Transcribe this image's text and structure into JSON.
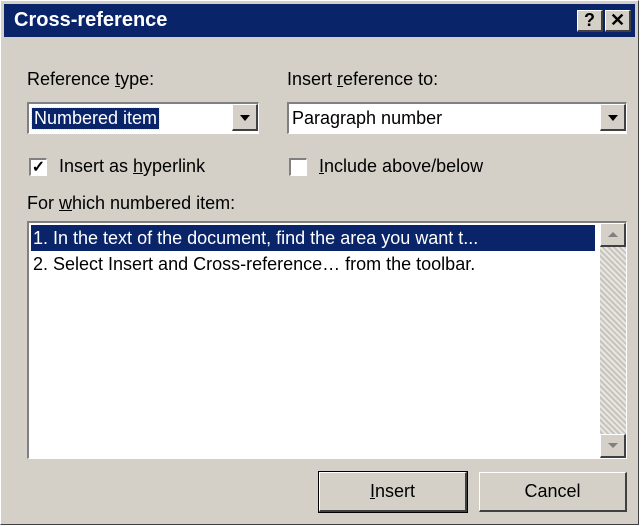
{
  "window": {
    "title": "Cross-reference",
    "help_icon": "question-mark-icon",
    "close_icon": "close-icon",
    "help_glyph": "?",
    "close_glyph": "✕"
  },
  "reference_type": {
    "label_prefix": "Reference ",
    "label_access": "t",
    "label_suffix": "ype:",
    "value": "Numbered item"
  },
  "insert_reference_to": {
    "label_prefix": "Insert ",
    "label_access": "r",
    "label_suffix": "eference to:",
    "value": "Paragraph number"
  },
  "insert_as_hyperlink": {
    "label_prefix": "Insert as ",
    "label_access": "h",
    "label_suffix": "yperlink",
    "checked": true,
    "check_glyph": "✓"
  },
  "include_above_below": {
    "label_prefix": "",
    "label_access": "I",
    "label_suffix": "nclude above/below",
    "checked": false
  },
  "numbered_items": {
    "label_prefix": "For ",
    "label_access": "w",
    "label_suffix": "hich numbered item:",
    "items": [
      "1. In the text of the document, find the area you want t...",
      "2. Select Insert and Cross-reference… from the toolbar."
    ],
    "selected_index": 0
  },
  "buttons": {
    "insert_access": "I",
    "insert_suffix": "nsert",
    "cancel": "Cancel"
  }
}
